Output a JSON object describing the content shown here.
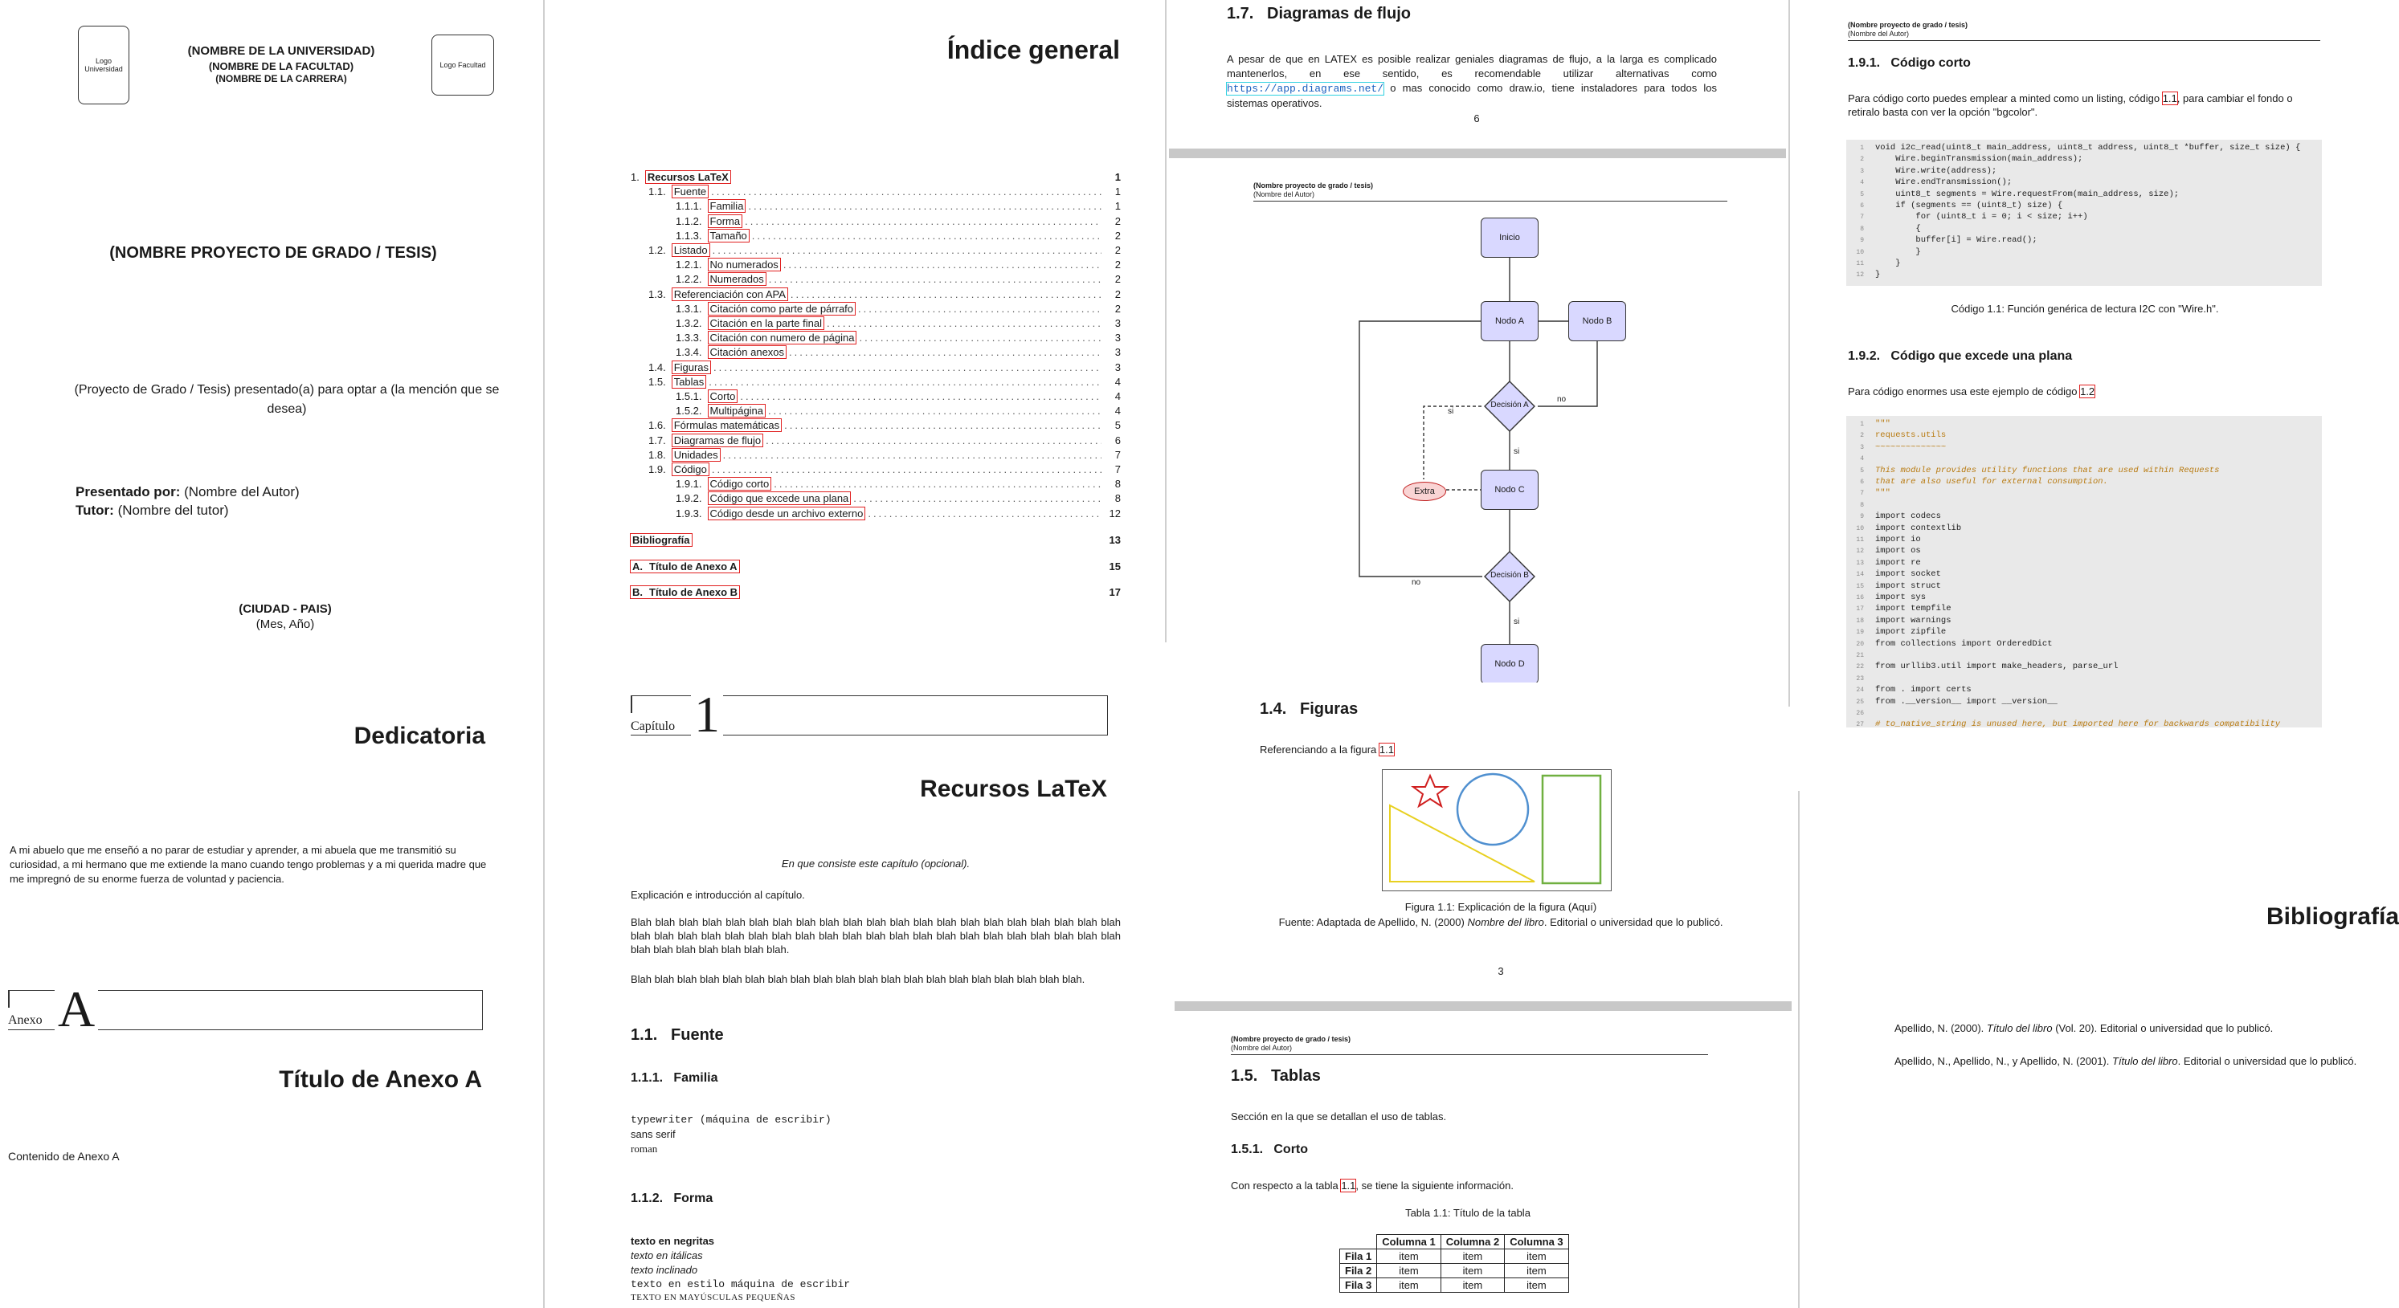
{
  "title_page": {
    "logo_left_line1": "Logo",
    "logo_left_line2": "Universidad",
    "university": "(NOMBRE DE LA UNIVERSIDAD)",
    "faculty": "(NOMBRE DE LA FACULTAD)",
    "career": "(NOMBRE DE LA CARRERA)",
    "logo_right": "Logo Facultad",
    "project_name": "(NOMBRE PROYECTO DE GRADO / TESIS)",
    "presented_for": "(Proyecto de Grado / Tesis) presentado(a) para optar a (la mención que se desea)",
    "presented_by_label": "Presentado por:",
    "presented_by_value": "(Nombre del Autor)",
    "tutor_label": "Tutor:",
    "tutor_value": "(Nombre del tutor)",
    "city": "(CIUDAD - PAIS)",
    "date": "(Mes, Año)"
  },
  "dedication_page": {
    "heading": "Dedicatoria",
    "text": "A mi abuelo que me enseñó a no parar de estudiar y aprender, a mi abuela que me transmitió su curiosidad, a mi hermano que me extiende la mano cuando tengo problemas y a mi querida madre que me impregnó de su enorme fuerza de voluntad y paciencia."
  },
  "annex_page": {
    "chapter_word": "Anexo",
    "chapter_letter": "A",
    "title": "Título de Anexo A",
    "content": "Contenido de Anexo A"
  },
  "toc_page": {
    "heading": "Índice general",
    "entries": [
      {
        "level": 0,
        "num": "1.",
        "label": "Recursos LaTeX",
        "page": "1",
        "bold": true,
        "boxed": true
      },
      {
        "level": 1,
        "num": "1.1.",
        "label": "Fuente",
        "page": "1"
      },
      {
        "level": 2,
        "num": "1.1.1.",
        "label": "Familia",
        "page": "1"
      },
      {
        "level": 2,
        "num": "1.1.2.",
        "label": "Forma",
        "page": "2"
      },
      {
        "level": 2,
        "num": "1.1.3.",
        "label": "Tamaño",
        "page": "2"
      },
      {
        "level": 1,
        "num": "1.2.",
        "label": "Listado",
        "page": "2"
      },
      {
        "level": 2,
        "num": "1.2.1.",
        "label": "No numerados",
        "page": "2"
      },
      {
        "level": 2,
        "num": "1.2.2.",
        "label": "Numerados",
        "page": "2"
      },
      {
        "level": 1,
        "num": "1.3.",
        "label": "Referenciación con APA",
        "page": "2"
      },
      {
        "level": 2,
        "num": "1.3.1.",
        "label": "Citación como parte de párrafo",
        "page": "2"
      },
      {
        "level": 2,
        "num": "1.3.2.",
        "label": "Citación en la parte final",
        "page": "3"
      },
      {
        "level": 2,
        "num": "1.3.3.",
        "label": "Citación con numero de página",
        "page": "3"
      },
      {
        "level": 2,
        "num": "1.3.4.",
        "label": "Citación anexos",
        "page": "3"
      },
      {
        "level": 1,
        "num": "1.4.",
        "label": "Figuras",
        "page": "3"
      },
      {
        "level": 1,
        "num": "1.5.",
        "label": "Tablas",
        "page": "4"
      },
      {
        "level": 2,
        "num": "1.5.1.",
        "label": "Corto",
        "page": "4"
      },
      {
        "level": 2,
        "num": "1.5.2.",
        "label": "Multipágina",
        "page": "4"
      },
      {
        "level": 1,
        "num": "1.6.",
        "label": "Fórmulas matemáticas",
        "page": "5"
      },
      {
        "level": 1,
        "num": "1.7.",
        "label": "Diagramas de flujo",
        "page": "6"
      },
      {
        "level": 1,
        "num": "1.8.",
        "label": "Unidades",
        "page": "7"
      },
      {
        "level": 1,
        "num": "1.9.",
        "label": "Código",
        "page": "7"
      },
      {
        "level": 2,
        "num": "1.9.1.",
        "label": "Código corto",
        "page": "8"
      },
      {
        "level": 2,
        "num": "1.9.2.",
        "label": "Código que excede una plana",
        "page": "8"
      },
      {
        "level": 2,
        "num": "1.9.3.",
        "label": "Código desde un archivo externo",
        "page": "12"
      }
    ],
    "bib": {
      "label": "Bibliografía",
      "page": "13"
    },
    "annex_a": {
      "num": "A.",
      "label": "Título de Anexo A",
      "page": "15"
    },
    "annex_b": {
      "num": "B.",
      "label": "Título de Anexo B",
      "page": "17"
    }
  },
  "chapter_page": {
    "chapter_word": "Capítulo",
    "chapter_number": "1",
    "title": "Recursos LaTeX",
    "intro_italic": "En que consiste este capítulo (opcional).",
    "intro": "Explicación e introducción al capítulo.",
    "blah1": "Blah blah blah blah blah blah blah blah blah blah blah blah blah blah blah blah blah blah blah blah blah blah blah blah blah blah blah blah blah blah blah blah blah blah blah blah blah blah blah blah blah blah blah blah blah blah blah blah blah.",
    "blah2": "Blah blah blah blah blah blah blah blah blah blah blah blah blah blah blah blah blah blah blah blah.",
    "s11": "1.1.   Fuente",
    "s111": "1.1.1.   Familia",
    "fam1": "typewriter (máquina de escribir)",
    "fam2": "sans serif",
    "fam3": "roman",
    "s112": "1.1.2.   Forma",
    "f1": "texto en negritas",
    "f2": "texto en itálicas",
    "f3": "texto inclinado",
    "f4": "texto en estilo máquina de escribir",
    "f5": "TEXTO EN MAYÚSCULAS PEQUEÑAS"
  },
  "flow_text_page": {
    "heading": "1.7.   Diagramas de flujo",
    "text_a": "A pesar de que en LATEX es posible realizar geniales diagramas de flujo, a la larga es complicado mantenerlos, en ese sentido, es recomendable utilizar alternativas como",
    "link": "https://app.diagrams.net/",
    "text_b": "o mas conocido como draw.io, tiene instaladores para todos los sistemas operativos.",
    "page_num": "6"
  },
  "flow_diagram_page": {
    "header1": "(Nombre proyecto de grado / tesis)",
    "header2": "(Nombre del Autor)",
    "nodes": {
      "inicio": "Inicio",
      "nodo_a": "Nodo A",
      "nodo_b": "Nodo B",
      "decision_a": "Decisión A",
      "nodo_c": "Nodo C",
      "extra": "Extra",
      "decision_b": "Decisión B",
      "nodo_d": "Nodo D"
    },
    "edge_labels": {
      "si1": "si",
      "no1": "no",
      "si2": "si",
      "no2": "no",
      "si3": "si"
    },
    "colors": {
      "node": "#d9d8ff",
      "extra": "#f9d4d4",
      "extra_border": "#c02020"
    }
  },
  "figures_page": {
    "heading": "1.4.   Figuras",
    "ref_text": "Referenciando a la figura",
    "ref": "1.1",
    "caption": "Figura 1.1: Explicación de la figura (Aquí)",
    "source_a": "Fuente: Adaptada de Apellido, N. (2000)",
    "source_book": "Nombre del libro",
    "source_b": ". Editorial o universidad que lo publicó.",
    "page_num": "3"
  },
  "tables_page": {
    "header1": "(Nombre proyecto de grado / tesis)",
    "header2": "(Nombre del Autor)",
    "heading": "1.5.   Tablas",
    "text": "Sección en la que se detallan el uso de tablas.",
    "s151": "1.5.1.   Corto",
    "ref_text_a": "Con respecto a la tabla",
    "ref": "1.1",
    "ref_text_b": ", se tiene la siguiente información.",
    "caption": "Tabla 1.1: Título de la tabla",
    "columns": [
      "",
      "Columna 1",
      "Columna 2",
      "Columna 3"
    ],
    "rows": [
      [
        "Fila 1",
        "item",
        "item",
        "item"
      ],
      [
        "Fila 2",
        "item",
        "item",
        "item"
      ],
      [
        "Fila 3",
        "item",
        "item",
        "item"
      ]
    ]
  },
  "code_page": {
    "header1": "(Nombre proyecto de grado / tesis)",
    "header2": "(Nombre del Autor)",
    "s191": "1.9.1.   Código corto",
    "short_text_a": "Para código corto puedes emplear a minted como un listing, código",
    "short_ref": "1.1",
    "short_text_b": ", para cambiar el fondo o retiralo basta con ver la opción \"bgcolor\".",
    "short_code": [
      "void i2c_read(uint8_t main_address, uint8_t address, uint8_t *buffer, size_t size) {",
      "    Wire.beginTransmission(main_address);",
      "    Wire.write(address);",
      "    Wire.endTransmission();",
      "    uint8_t segments = Wire.requestFrom(main_address, size);",
      "    if (segments == (uint8_t) size) {",
      "        for (uint8_t i = 0; i < size; i++)",
      "        {",
      "        buffer[i] = Wire.read();",
      "        }",
      "    }",
      "}"
    ],
    "short_caption": "Código 1.1: Función genérica de lectura I2C con \"Wire.h\".",
    "s192": "1.9.2.   Código que excede una plana",
    "long_text_a": "Para código enormes usa este ejemplo de código",
    "long_ref": "1.2",
    "long_code": [
      "\"\"\"",
      "requests.utils",
      "~~~~~~~~~~~~~~",
      "",
      "This module provides utility functions that are used within Requests",
      "that are also useful for external consumption.",
      "\"\"\"",
      "",
      "import codecs",
      "import contextlib",
      "import io",
      "import os",
      "import re",
      "import socket",
      "import struct",
      "import sys",
      "import tempfile",
      "import warnings",
      "import zipfile",
      "from collections import OrderedDict",
      "",
      "from urllib3.util import make_headers, parse_url",
      "",
      "from . import certs",
      "from .__version__ import __version__",
      "",
      "# to_native_string is unused here, but imported here for backwards compatibility"
    ]
  },
  "bib_page": {
    "heading": "Bibliografía",
    "ref1_a": "Apellido, N. (2000).",
    "ref1_title": "Título del libro",
    "ref1_b": "(Vol. 20). Editorial o universidad que lo publicó.",
    "ref2_a": "Apellido, N., Apellido, N., y Apellido, N. (2001).",
    "ref2_title": "Título del libro",
    "ref2_b": ". Editorial o universidad que lo publicó."
  }
}
